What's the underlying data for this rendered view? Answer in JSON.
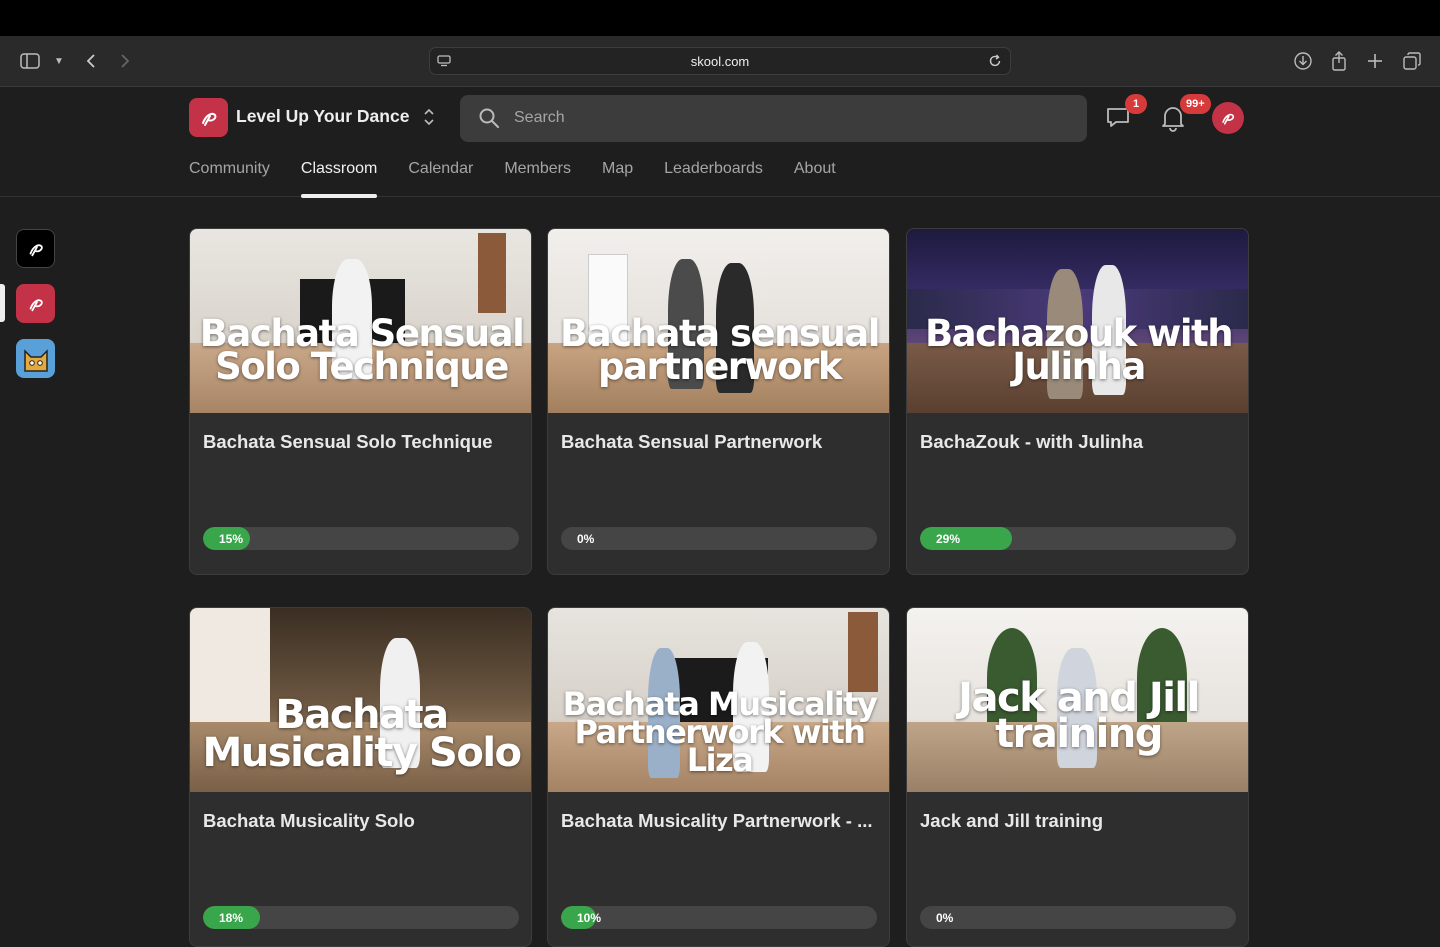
{
  "browser": {
    "url": "skool.com"
  },
  "header": {
    "group_name": "Level Up Your Dance",
    "search_placeholder": "Search",
    "chat_badge": "1",
    "notif_badge": "99+"
  },
  "nav": {
    "tabs": [
      {
        "label": "Community"
      },
      {
        "label": "Classroom"
      },
      {
        "label": "Calendar"
      },
      {
        "label": "Members"
      },
      {
        "label": "Map"
      },
      {
        "label": "Leaderboards"
      },
      {
        "label": "About"
      }
    ],
    "active": "Classroom"
  },
  "courses": [
    {
      "title": "Bachata Sensual Solo Technique",
      "overlay": [
        "Bachata Sensual",
        "Solo Technique"
      ],
      "progress": 15,
      "progress_label": "15%"
    },
    {
      "title": "Bachata Sensual Partnerwork",
      "overlay": [
        "Bachata sensual",
        "partnerwork"
      ],
      "progress": 0,
      "progress_label": "0%"
    },
    {
      "title": "BachaZouk - with Julinha",
      "overlay": [
        "Bachazouk with",
        "Julinha"
      ],
      "progress": 29,
      "progress_label": "29%"
    },
    {
      "title": "Bachata Musicality Solo",
      "overlay": [
        "Bachata",
        "Musicality Solo"
      ],
      "progress": 18,
      "progress_label": "18%"
    },
    {
      "title": "Bachata Musicality Partnerwork - ...",
      "overlay": [
        "Bachata Musicality",
        "Partnerwork with Liza"
      ],
      "progress": 10,
      "progress_label": "10%"
    },
    {
      "title": "Jack and Jill training",
      "overlay": [
        "Jack and Jill",
        "training"
      ],
      "progress": 0,
      "progress_label": "0%"
    }
  ],
  "colors": {
    "accent": "#c33246",
    "progress": "#3aa64c"
  }
}
